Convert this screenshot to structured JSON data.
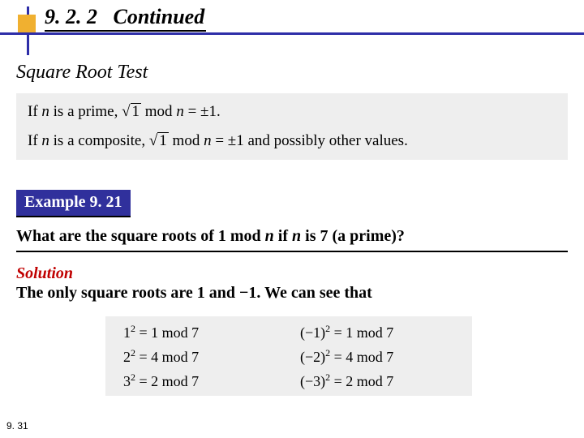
{
  "header": {
    "section_number": "9. 2. 2",
    "continued": "Continued",
    "subtitle": "Square Root Test"
  },
  "box1": {
    "line1_prefix": "If ",
    "line1_var": "n",
    "line1_mid": " is a prime,  ",
    "line1_radicand": "1",
    "line1_after": " mod ",
    "line1_var2": "n",
    "line1_end": " = ±1.",
    "line2_prefix": "If ",
    "line2_var": "n",
    "line2_mid": " is a composite,  ",
    "line2_radicand": "1",
    "line2_after": " mod ",
    "line2_var2": "n",
    "line2_end": " = ±1 and possibly other values."
  },
  "example": {
    "label": "Example 9. 21",
    "question_pre": "What are the square roots of 1 mod ",
    "question_var1": "n",
    "question_mid": " if ",
    "question_var2": "n",
    "question_post": " is 7 (a prime)?",
    "solution_label": "Solution",
    "solution_body": "The only square roots are 1 and −1. We can see that"
  },
  "box2": {
    "l1": {
      "base": "1",
      "exp": "2",
      "rhs": " = 1 mod 7"
    },
    "l2": {
      "base": "2",
      "exp": "2",
      "rhs": " = 4 mod 7"
    },
    "l3": {
      "base": "3",
      "exp": "2",
      "rhs": " = 2 mod 7"
    },
    "r1": {
      "base": "(−1)",
      "exp": "2",
      "rhs": " = 1 mod 7"
    },
    "r2": {
      "base": "(−2)",
      "exp": "2",
      "rhs": " = 4 mod 7"
    },
    "r3": {
      "base": "(−3)",
      "exp": "2",
      "rhs": " = 2 mod 7"
    }
  },
  "page_number": "9. 31"
}
